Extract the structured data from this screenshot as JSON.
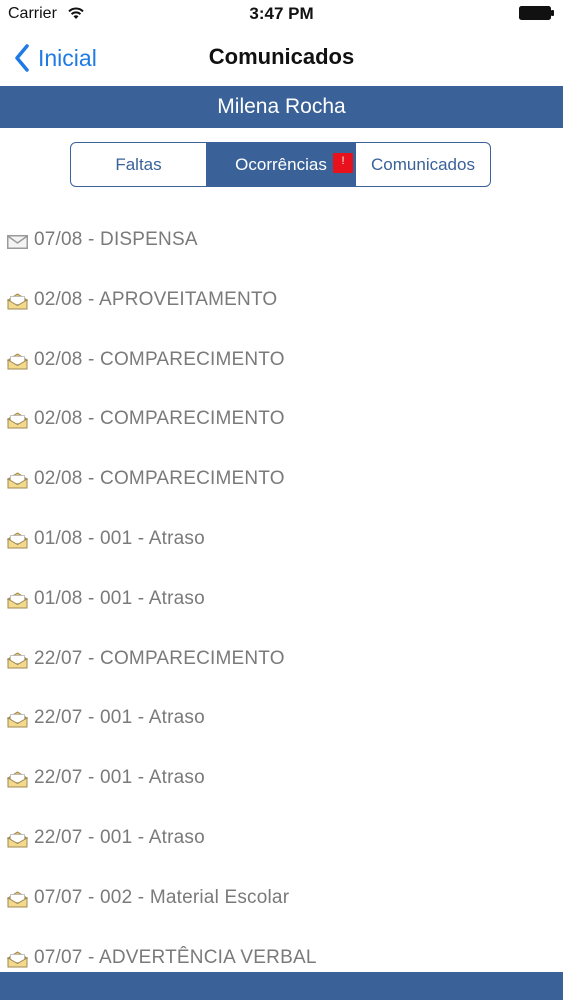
{
  "status_bar": {
    "carrier": "Carrier",
    "time": "3:47 PM"
  },
  "nav": {
    "back_label": "Inicial",
    "title": "Comunicados"
  },
  "student": {
    "name": "Milena Rocha"
  },
  "tabs": [
    {
      "label": "Faltas",
      "selected": false
    },
    {
      "label": "Ocorrências",
      "selected": true,
      "badge": "!"
    },
    {
      "label": "Comunicados",
      "selected": false
    }
  ],
  "messages": [
    {
      "text": "07/08 - DISPENSA",
      "icon": "envelope-closed-icon",
      "read": true
    },
    {
      "text": "02/08 - APROVEITAMENTO",
      "icon": "envelope-open-icon",
      "read": false
    },
    {
      "text": "02/08 - COMPARECIMENTO",
      "icon": "envelope-open-icon",
      "read": false
    },
    {
      "text": "02/08 - COMPARECIMENTO",
      "icon": "envelope-open-icon",
      "read": false
    },
    {
      "text": "02/08 - COMPARECIMENTO",
      "icon": "envelope-open-icon",
      "read": false
    },
    {
      "text": "01/08 - 001 - Atraso",
      "icon": "envelope-open-icon",
      "read": false
    },
    {
      "text": "01/08 - 001 - Atraso",
      "icon": "envelope-open-icon",
      "read": false
    },
    {
      "text": "22/07 - COMPARECIMENTO",
      "icon": "envelope-open-icon",
      "read": false
    },
    {
      "text": "22/07 - 001 - Atraso",
      "icon": "envelope-open-icon",
      "read": false
    },
    {
      "text": "22/07 - 001 - Atraso",
      "icon": "envelope-open-icon",
      "read": false
    },
    {
      "text": "22/07 - 001 - Atraso",
      "icon": "envelope-open-icon",
      "read": false
    },
    {
      "text": "07/07 - 002 - Material Escolar",
      "icon": "envelope-open-icon",
      "read": false
    },
    {
      "text": "07/07 - ADVERTÊNCIA VERBAL",
      "icon": "envelope-open-icon",
      "read": false
    }
  ],
  "colors": {
    "accent": "#3a6298",
    "link": "#1f7ae5",
    "badge": "#e8121c",
    "item_text": "#7a7a7a"
  }
}
